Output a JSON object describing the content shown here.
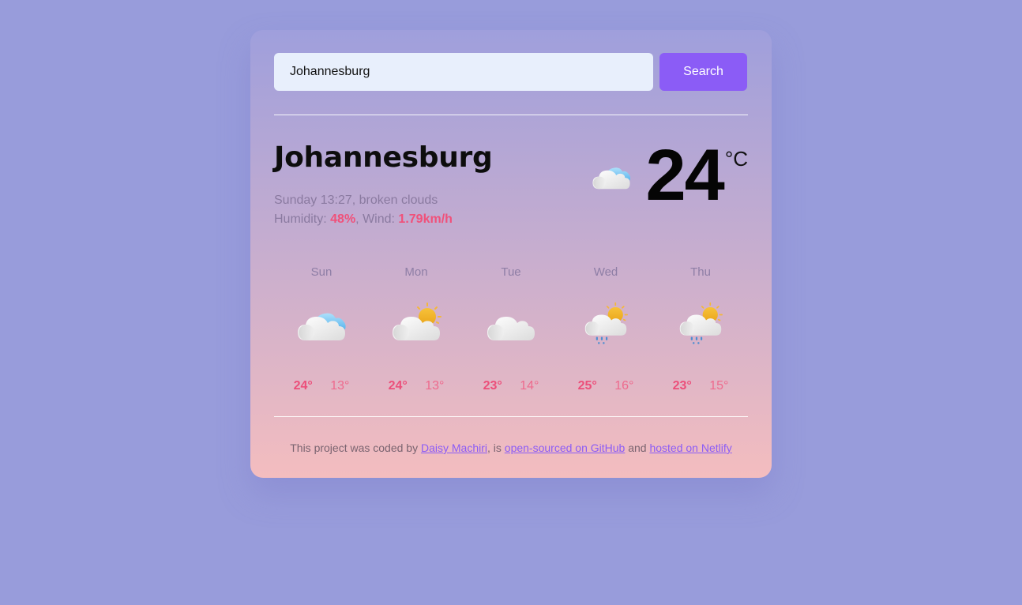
{
  "search": {
    "value": "Johannesburg",
    "button_label": "Search"
  },
  "current": {
    "city": "Johannesburg",
    "day_time": "Sunday 13:27",
    "description": "broken clouds",
    "humidity_label": "Humidity:",
    "humidity_value": "48%",
    "wind_label": "Wind:",
    "wind_value": "1.79km/h",
    "temperature": "24",
    "unit": "°C",
    "icon": "broken-clouds-icon"
  },
  "forecast": [
    {
      "day": "Sun",
      "icon": "broken-clouds-icon",
      "max": "24°",
      "min": "13°"
    },
    {
      "day": "Mon",
      "icon": "few-clouds-icon",
      "max": "24°",
      "min": "13°"
    },
    {
      "day": "Tue",
      "icon": "cloud-icon",
      "max": "23°",
      "min": "14°"
    },
    {
      "day": "Wed",
      "icon": "sun-rain-cloud-icon",
      "max": "25°",
      "min": "16°"
    },
    {
      "day": "Thu",
      "icon": "sun-rain-cloud-icon",
      "max": "23°",
      "min": "15°"
    }
  ],
  "footer": {
    "text_1": "This project was coded by ",
    "author_link": "Daisy Machiri",
    "text_2": ", is ",
    "github_link": "open-sourced on GitHub",
    "text_3": " and ",
    "netlify_link": "hosted on Netlify"
  },
  "colors": {
    "accent": "#8b5cf6",
    "highlight": "#f0517a",
    "page_background": "#989cdb"
  }
}
